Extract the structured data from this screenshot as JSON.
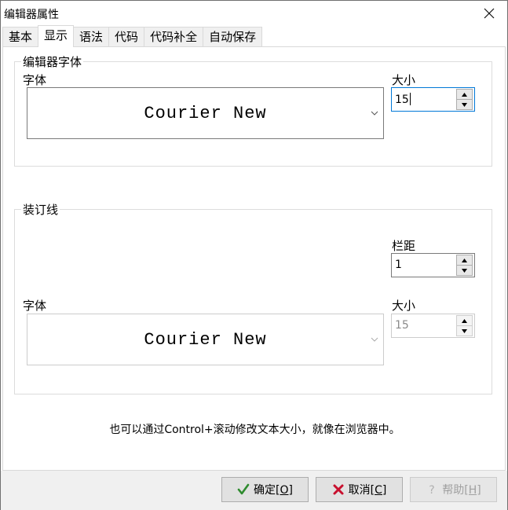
{
  "window": {
    "title": "编辑器属性",
    "close_label": "✕"
  },
  "tabs": [
    {
      "label": "基本"
    },
    {
      "label": "显示"
    },
    {
      "label": "语法"
    },
    {
      "label": "代码"
    },
    {
      "label": "代码补全"
    },
    {
      "label": "自动保存"
    }
  ],
  "active_tab": "显示",
  "editor_font": {
    "group_title": "编辑器字体",
    "font_label": "字体",
    "font_value": "Courier New",
    "size_label": "大小",
    "size_value": "15"
  },
  "gutter": {
    "group_title": "装订线",
    "margin_label": "栏距",
    "margin_value": "1",
    "font_label": "字体",
    "font_value": "Courier New",
    "size_label": "大小",
    "size_value": "15"
  },
  "hint": "也可以通过Control+滚动修改文本大小，就像在浏览器中。",
  "buttons": {
    "ok": {
      "label": "确定",
      "shortcut": "[O]"
    },
    "cancel": {
      "label": "取消",
      "shortcut": "[C]"
    },
    "help": {
      "label": "帮助",
      "shortcut": "[H]"
    }
  },
  "colors": {
    "ok_check": "#2e8b2e",
    "cancel_x": "#c8102e",
    "focus_border": "#0078d7"
  }
}
